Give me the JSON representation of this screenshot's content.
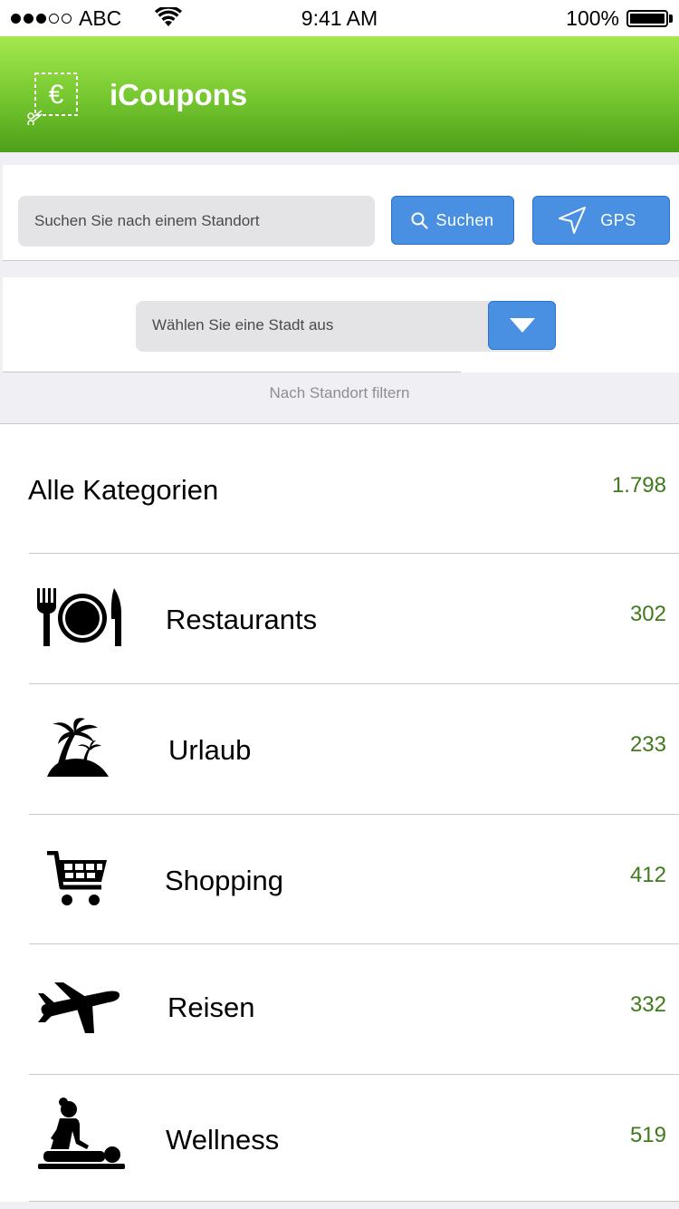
{
  "status_bar": {
    "carrier": "ABC",
    "time": "9:41 AM",
    "battery": "100%"
  },
  "header": {
    "title": "iCoupons",
    "logo_icon": "euro-coupon-icon"
  },
  "search": {
    "placeholder": "Suchen Sie nach einem Standort",
    "search_label": "Suchen",
    "gps_label": "GPS"
  },
  "city_filter": {
    "selected": "Wählen Sie eine Stadt aus",
    "caption": "Nach Standort filtern"
  },
  "categories": {
    "all": {
      "label": "Alle Kategorien",
      "count": "1.798"
    },
    "items": [
      {
        "label": "Restaurants",
        "count": "302",
        "icon": "restaurant-icon"
      },
      {
        "label": "Urlaub",
        "count": "233",
        "icon": "palm-island-icon"
      },
      {
        "label": "Shopping",
        "count": "412",
        "icon": "shopping-cart-icon"
      },
      {
        "label": "Reisen",
        "count": "332",
        "icon": "airplane-icon"
      },
      {
        "label": "Wellness",
        "count": "519",
        "icon": "massage-icon"
      }
    ]
  },
  "colors": {
    "header_top": "#a5e84e",
    "header_bottom": "#4e9f19",
    "button_blue": "#4a90e2",
    "count_green": "#3f7a1c"
  }
}
